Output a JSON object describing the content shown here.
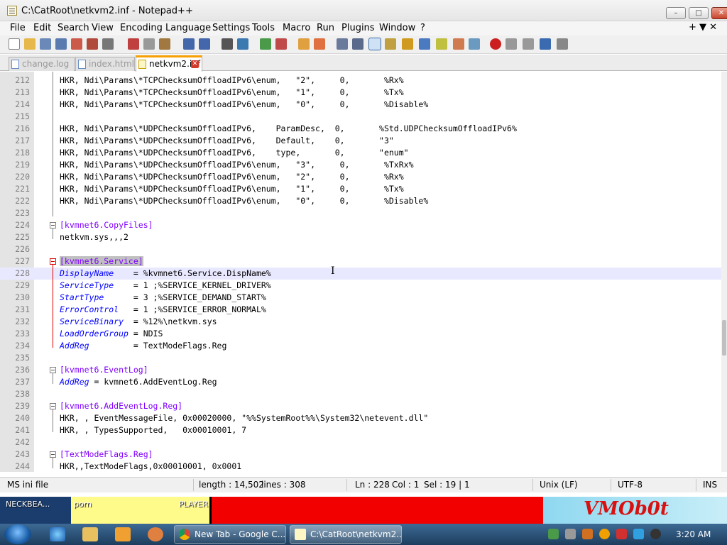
{
  "window": {
    "title": "C:\\CatRoot\\netkvm2.inf - Notepad++",
    "min": "–",
    "max": "□",
    "close": "✕"
  },
  "menu": [
    "File",
    "Edit",
    "Search",
    "View",
    "Encoding",
    "Language",
    "Settings",
    "Tools",
    "Macro",
    "Run",
    "Plugins",
    "Window",
    "?"
  ],
  "menu_right": "+ ▼ ✕",
  "tabs": [
    {
      "label": "change.log",
      "active": false
    },
    {
      "label": "index.html",
      "active": false
    },
    {
      "label": "netkvm2.inf",
      "active": true
    }
  ],
  "lines": [
    {
      "n": "212",
      "t": "HKR, Ndi\\Params\\*TCPChecksumOffloadIPv6\\enum,   \"2\",     0,       %Rx%"
    },
    {
      "n": "213",
      "t": "HKR, Ndi\\Params\\*TCPChecksumOffloadIPv6\\enum,   \"1\",     0,       %Tx%"
    },
    {
      "n": "214",
      "t": "HKR, Ndi\\Params\\*TCPChecksumOffloadIPv6\\enum,   \"0\",     0,       %Disable%"
    },
    {
      "n": "215",
      "t": ""
    },
    {
      "n": "216",
      "t": "HKR, Ndi\\Params\\*UDPChecksumOffloadIPv6,    ParamDesc,  0,       %Std.UDPChecksumOffloadIPv6%"
    },
    {
      "n": "217",
      "t": "HKR, Ndi\\Params\\*UDPChecksumOffloadIPv6,    Default,    0,       \"3\""
    },
    {
      "n": "218",
      "t": "HKR, Ndi\\Params\\*UDPChecksumOffloadIPv6,    type,       0,       \"enum\""
    },
    {
      "n": "219",
      "t": "HKR, Ndi\\Params\\*UDPChecksumOffloadIPv6\\enum,   \"3\",     0,       %TxRx%"
    },
    {
      "n": "220",
      "t": "HKR, Ndi\\Params\\*UDPChecksumOffloadIPv6\\enum,   \"2\",     0,       %Rx%"
    },
    {
      "n": "221",
      "t": "HKR, Ndi\\Params\\*UDPChecksumOffloadIPv6\\enum,   \"1\",     0,       %Tx%"
    },
    {
      "n": "222",
      "t": "HKR, Ndi\\Params\\*UDPChecksumOffloadIPv6\\enum,   \"0\",     0,       %Disable%"
    },
    {
      "n": "223",
      "t": ""
    },
    {
      "n": "224",
      "s": "[kvmnet6.CopyFiles]"
    },
    {
      "n": "225",
      "t": "netkvm.sys,,,2"
    },
    {
      "n": "226",
      "t": ""
    },
    {
      "n": "227",
      "s": "[kvmnet6.Service]"
    },
    {
      "n": "228",
      "k": "DisplayName    ",
      "t": "= %kvmnet6.Service.DispName%"
    },
    {
      "n": "229",
      "k": "ServiceType    ",
      "t": "= 1 ;%SERVICE_KERNEL_DRIVER%"
    },
    {
      "n": "230",
      "k": "StartType      ",
      "t": "= 3 ;%SERVICE_DEMAND_START%"
    },
    {
      "n": "231",
      "k": "ErrorControl   ",
      "t": "= 1 ;%SERVICE_ERROR_NORMAL%"
    },
    {
      "n": "232",
      "k": "ServiceBinary  ",
      "t": "= %12%\\netkvm.sys"
    },
    {
      "n": "233",
      "k": "LoadOrderGroup ",
      "t": "= NDIS"
    },
    {
      "n": "234",
      "k": "AddReg         ",
      "t": "= TextModeFlags.Reg"
    },
    {
      "n": "235",
      "t": ""
    },
    {
      "n": "236",
      "s": "[kvmnet6.EventLog]"
    },
    {
      "n": "237",
      "k": "AddReg ",
      "t": "= kvmnet6.AddEventLog.Reg"
    },
    {
      "n": "238",
      "t": ""
    },
    {
      "n": "239",
      "s": "[kvmnet6.AddEventLog.Reg]"
    },
    {
      "n": "240",
      "t": "HKR, , EventMessageFile, 0x00020000, \"%%SystemRoot%%\\System32\\netevent.dll\""
    },
    {
      "n": "241",
      "t": "HKR, , TypesSupported,   0x00010001, 7"
    },
    {
      "n": "242",
      "t": ""
    },
    {
      "n": "243",
      "s": "[TextModeFlags.Reg]"
    },
    {
      "n": "244",
      "t": "HKR,,TextModeFlags,0x00010001, 0x0001"
    }
  ],
  "status": {
    "filetype": "MS ini file",
    "length": "length : 14,502",
    "lines": "lines : 308",
    "ln": "Ln : 228",
    "col": "Col : 1",
    "sel": "Sel : 19 | 1",
    "eol": "Unix (LF)",
    "encoding": "UTF-8",
    "mode": "INS"
  },
  "desktop": {
    "label1": "NECKBEA...",
    "label2": "porn",
    "label3": "PLAYER",
    "logo": "VMOb0t"
  },
  "taskbar": {
    "tasks": [
      "New Tab - Google C...",
      "C:\\CatRoot\\netkvm2..."
    ],
    "clock": "3:20 AM"
  }
}
